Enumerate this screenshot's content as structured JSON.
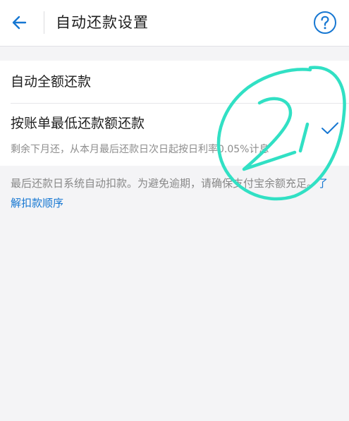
{
  "header": {
    "title": "自动还款设置",
    "back_icon": "arrow-left-icon",
    "help_icon": "question-circle-icon"
  },
  "options": [
    {
      "label": "自动全额还款",
      "selected": false
    },
    {
      "label": "按账单最低还款额还款",
      "description": "剩余下月还，从本月最后还款日次日起按日利率0.05%计息",
      "selected": true
    }
  ],
  "info": {
    "text": "最后还款日系统自动扣款。为避免逾期，请确保支付宝余额充足。",
    "link": "了解扣款顺序"
  },
  "annotation": {
    "text": "2",
    "color": "#31e0c4"
  },
  "colors": {
    "accent": "#1677d2",
    "background": "#f4f4f6"
  }
}
